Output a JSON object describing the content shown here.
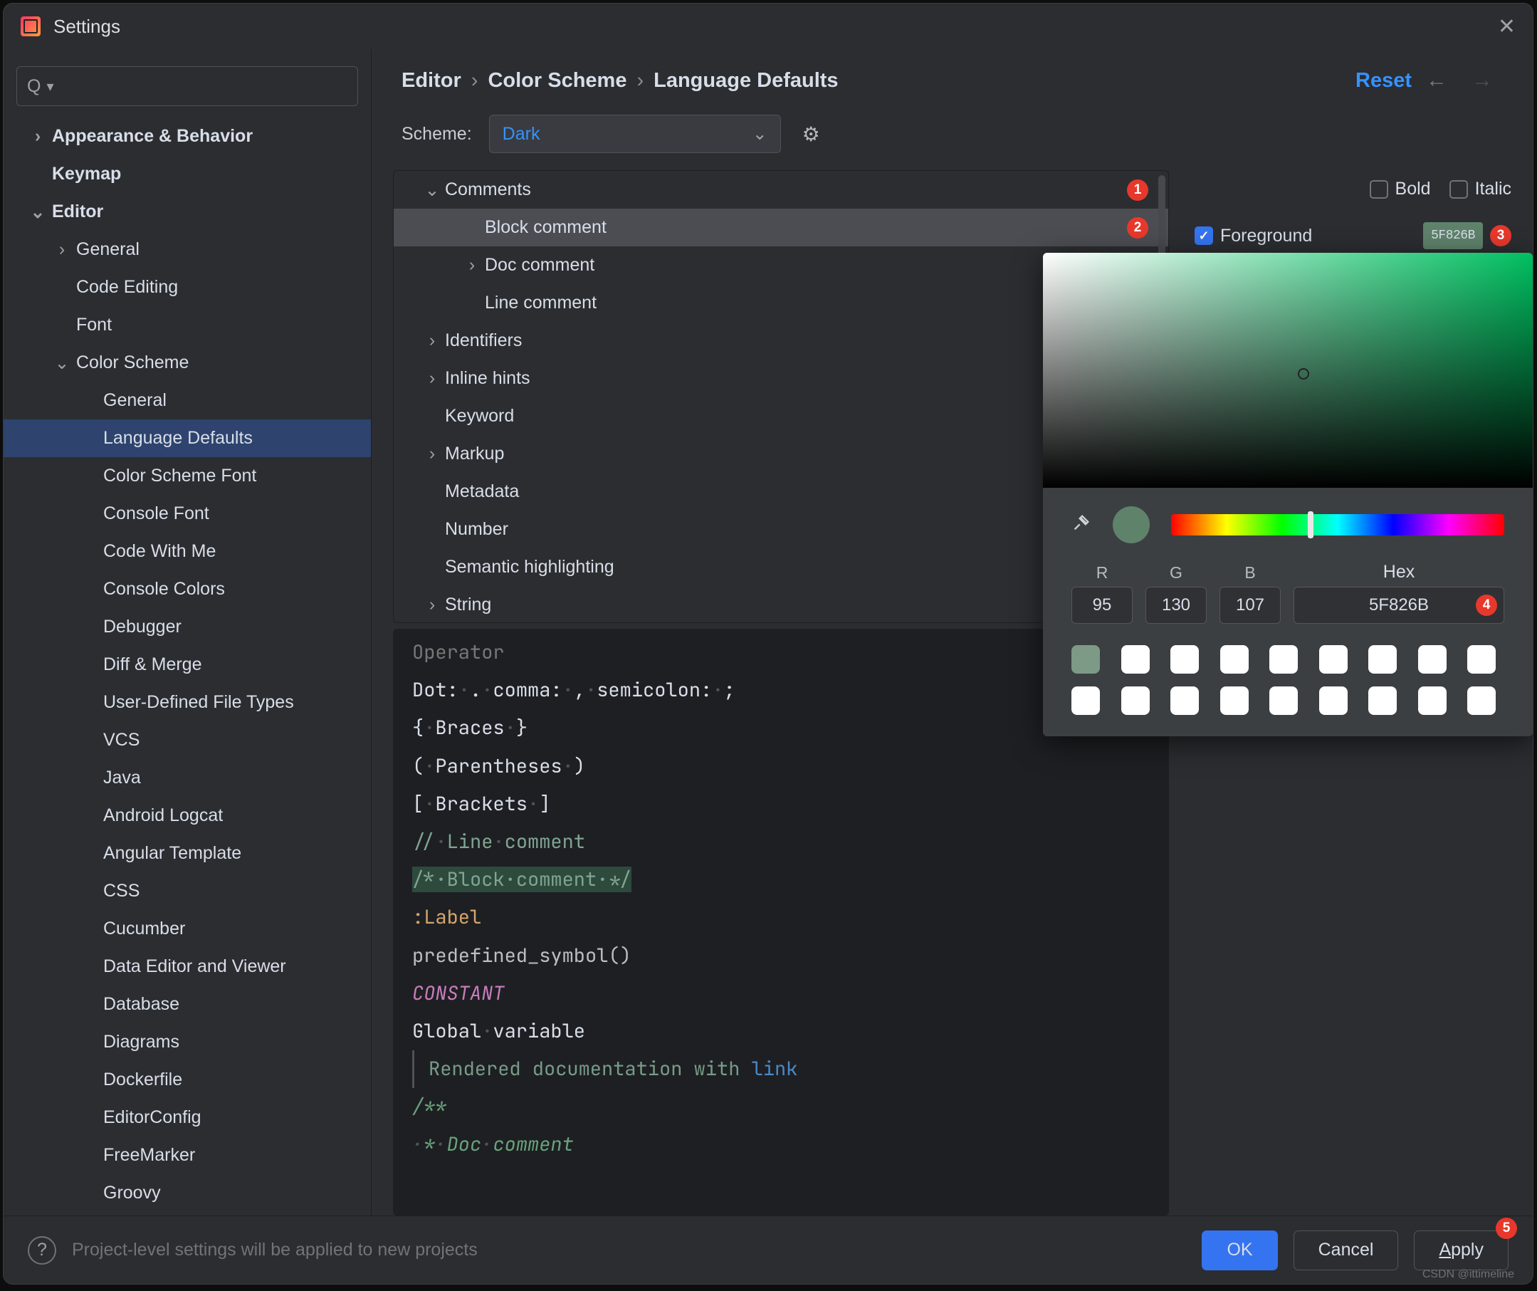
{
  "window": {
    "title": "Settings"
  },
  "search": {
    "placeholder": ""
  },
  "nav": {
    "appearance": "Appearance & Behavior",
    "keymap": "Keymap",
    "editor": "Editor",
    "general": "General",
    "codeEditing": "Code Editing",
    "font": "Font",
    "colorScheme": "Color Scheme",
    "items": [
      "General",
      "Language Defaults",
      "Color Scheme Font",
      "Console Font",
      "Code With Me",
      "Console Colors",
      "Debugger",
      "Diff & Merge",
      "User-Defined File Types",
      "VCS",
      "Java",
      "Android Logcat",
      "Angular Template",
      "CSS",
      "Cucumber",
      "Data Editor and Viewer",
      "Database",
      "Diagrams",
      "Dockerfile",
      "EditorConfig",
      "FreeMarker",
      "Groovy"
    ],
    "selected": "Language Defaults"
  },
  "breadcrumb": [
    "Editor",
    "Color Scheme",
    "Language Defaults"
  ],
  "reset": "Reset",
  "scheme": {
    "label": "Scheme:",
    "value": "Dark"
  },
  "categories": [
    {
      "label": "Comments",
      "depth": 0,
      "arrow": "down",
      "badge": 1
    },
    {
      "label": "Block comment",
      "depth": 1,
      "sel": true,
      "badge": 2
    },
    {
      "label": "Doc comment",
      "depth": 1,
      "arrow": "right"
    },
    {
      "label": "Line comment",
      "depth": 1
    },
    {
      "label": "Identifiers",
      "depth": 0,
      "arrow": "right"
    },
    {
      "label": "Inline hints",
      "depth": 0,
      "arrow": "right"
    },
    {
      "label": "Keyword",
      "depth": 0
    },
    {
      "label": "Markup",
      "depth": 0,
      "arrow": "right"
    },
    {
      "label": "Metadata",
      "depth": 0
    },
    {
      "label": "Number",
      "depth": 0
    },
    {
      "label": "Semantic highlighting",
      "depth": 0
    },
    {
      "label": "String",
      "depth": 0,
      "arrow": "right"
    }
  ],
  "props": {
    "bold": "Bold",
    "italic": "Italic",
    "foreground": "Foreground",
    "fg_hex": "5F826B",
    "fg_badge": 3
  },
  "picker": {
    "r_label": "R",
    "g_label": "G",
    "b_label": "B",
    "hex_label": "Hex",
    "r": "95",
    "g": "130",
    "b": "107",
    "hex": "5F826B",
    "hex_badge": 4
  },
  "preview": {
    "l0": "Operator",
    "l1a": "Dot:",
    "l1b": "comma:",
    "l1c": "semicolon:",
    "l2a": "{",
    "l2b": "Braces",
    "l2c": "}",
    "l3a": "(",
    "l3b": "Parentheses",
    "l3c": ")",
    "l4a": "[",
    "l4b": "Brackets",
    "l4c": "]",
    "l5": "// Line comment",
    "l6": "/* Block comment */",
    "l7": ":Label",
    "l8": "predefined_symbol()",
    "l9": "CONSTANT",
    "l10": "Global variable",
    "l11a": "Rendered documentation with ",
    "l11b": "link",
    "l12": "/**",
    "l13": " * Doc comment"
  },
  "footer": {
    "hint": "Project-level settings will be applied to new projects",
    "ok": "OK",
    "cancel": "Cancel",
    "apply": "pply",
    "apply_u": "A",
    "apply_badge": 5
  },
  "watermark": "CSDN @ittimeline"
}
